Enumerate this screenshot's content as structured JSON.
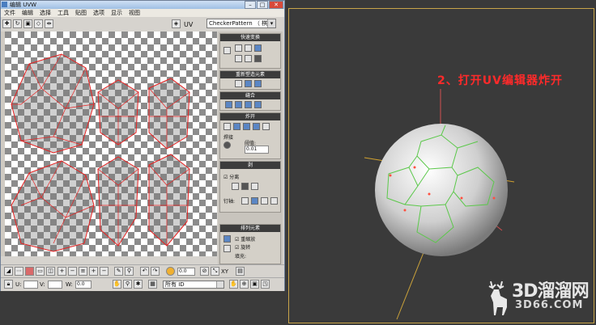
{
  "window": {
    "title": "编辑 UVW",
    "min_label": "–",
    "max_label": "□",
    "close_label": "✕"
  },
  "menu": [
    "文件",
    "编辑",
    "选择",
    "工具",
    "贴图",
    "选项",
    "显示",
    "视图"
  ],
  "toolbar": {
    "uv_label": "UV",
    "texture_select": "CheckerPattern （ 棋盘"
  },
  "rollouts": {
    "quick_transform": "快速变换",
    "reshape_elements": "重新塑造元素",
    "stitch": "缝合",
    "explode": "炸开",
    "weld": "焊接",
    "threshold_label": "阈值:",
    "threshold_value": "0.01",
    "peel": "剥",
    "detach": "分离",
    "pins": "钉轴:",
    "arrange": "排列元素",
    "rescale": "重缩放",
    "rotate": "旋转",
    "padding": "填充:"
  },
  "bottom": {
    "u_label": "U:",
    "v_label": "V:",
    "w_label": "W:",
    "w_value": "0.0",
    "xy_label": "XY",
    "zoom_value": "0.0",
    "id_select": "所有 ID"
  },
  "annotation": "2、打开UV编辑器炸开",
  "watermark": {
    "line1": "3D溜溜网",
    "line2": "3D66.COM"
  },
  "colors": {
    "uv_wire": "#e82020",
    "seam_green": "#5bc84a",
    "annotation": "#ff2a2a",
    "viewport_bg": "#3a3a3a"
  }
}
